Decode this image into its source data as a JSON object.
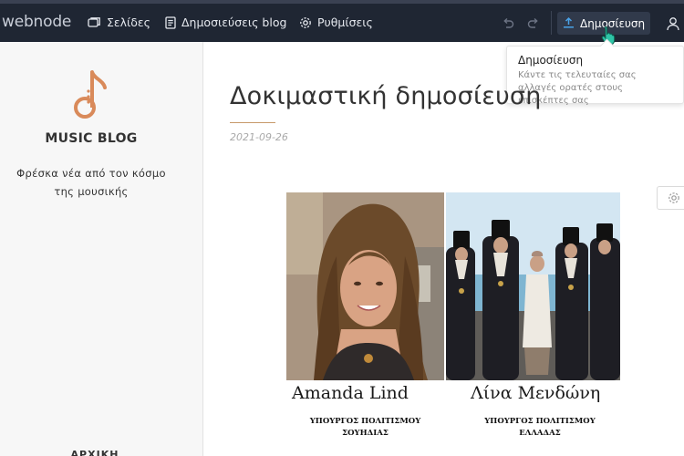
{
  "app": {
    "logo": "webnode"
  },
  "nav": {
    "pages": "Σελίδες",
    "blog_posts": "Δημοσιεύσεις blog",
    "settings": "Ρυθμίσεις"
  },
  "toolbar": {
    "publish_label": "Δημοσίευση"
  },
  "tooltip": {
    "title": "Δημοσίευση",
    "text": "Κάντε τις τελευταίες σας αλλαγές ορατές στους επισκέπτες σας"
  },
  "sidebar": {
    "blog_name": "MUSIC BLOG",
    "tagline": "Φρέσκα νέα από τον κόσμο της μουσικής",
    "home_link": "ΑΡΧΙΚΗ"
  },
  "post": {
    "title": "Δοκιμαστική δημοσίευση",
    "date": "2021-09-26",
    "image": {
      "left_name": "Amanda Lind",
      "left_caption_1": "ΥΠΟΥΡΓΟΣ ΠΟΛΙΤΙΣΜΟΥ",
      "left_caption_2": "ΣΟΥΗΔΙΑΣ",
      "right_name": "Λίνα Μενδώνη",
      "right_caption_1": "ΥΠΟΥΡΓΟΣ ΠΟΛΙΤΙΣΜΟΥ",
      "right_caption_2": "ΕΛΛΑΔΑΣ"
    }
  },
  "colors": {
    "topbar": "#1f2633",
    "accent": "#ffffff",
    "brand_orange": "#d98a5a",
    "publish_icon": "#4aa3e8"
  }
}
